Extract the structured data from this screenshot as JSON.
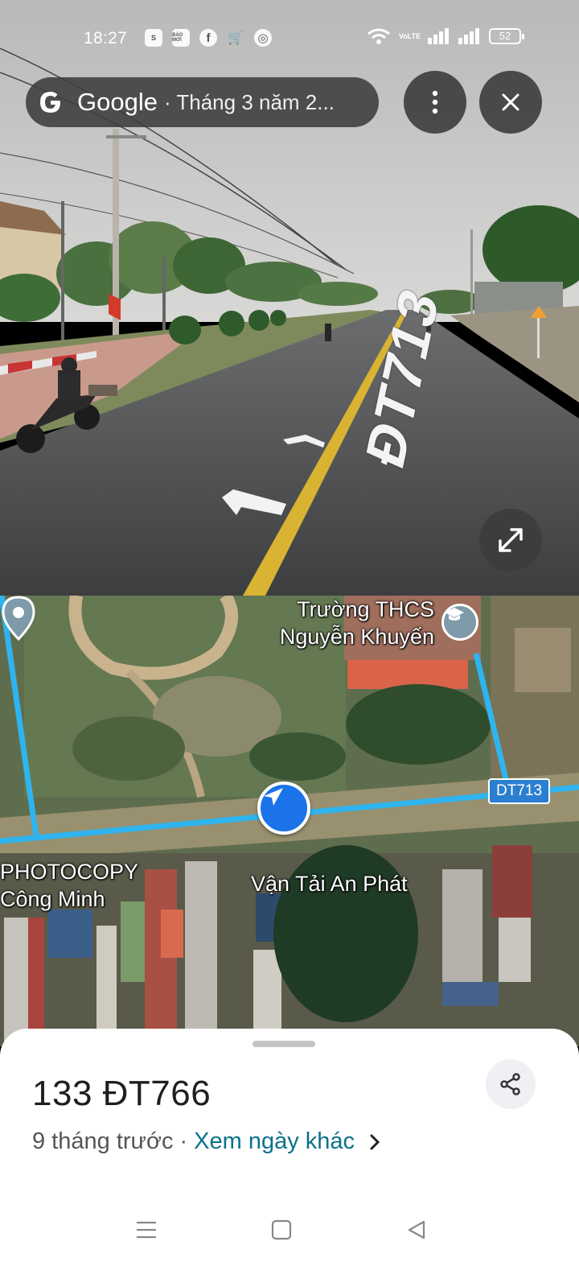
{
  "status_bar": {
    "time": "18:27",
    "apps": [
      {
        "name": "shopee-icon",
        "glyph": "S"
      },
      {
        "name": "baomoi-icon",
        "glyph": "BÁO MỚI"
      },
      {
        "name": "facebook-icon",
        "glyph": "f"
      },
      {
        "name": "cart-app-icon",
        "glyph": "🛒"
      },
      {
        "name": "chrome-icon",
        "glyph": "◎"
      }
    ],
    "volte": "VoLTE",
    "battery": "52"
  },
  "street_view": {
    "brand": "Google",
    "date_text": "· Tháng 3 năm 2...",
    "road_marking": "ĐT713"
  },
  "map": {
    "school_label_line1": "Trường THCS",
    "school_label_line2": "Nguyễn Khuyến",
    "road_shield": "DT713",
    "photocopy_line1": "PHOTOCOPY",
    "photocopy_line2": "Công Minh",
    "vantai_label": "Vận Tải An Phát"
  },
  "sheet": {
    "address": "133 ĐT766",
    "time_ago": "9 tháng trước",
    "separator": "·",
    "other_dates_link": "Xem ngày khác"
  },
  "colors": {
    "accent_blue": "#1a73e8",
    "route_cyan": "#2fb4ee",
    "link_teal": "#0a7289"
  }
}
